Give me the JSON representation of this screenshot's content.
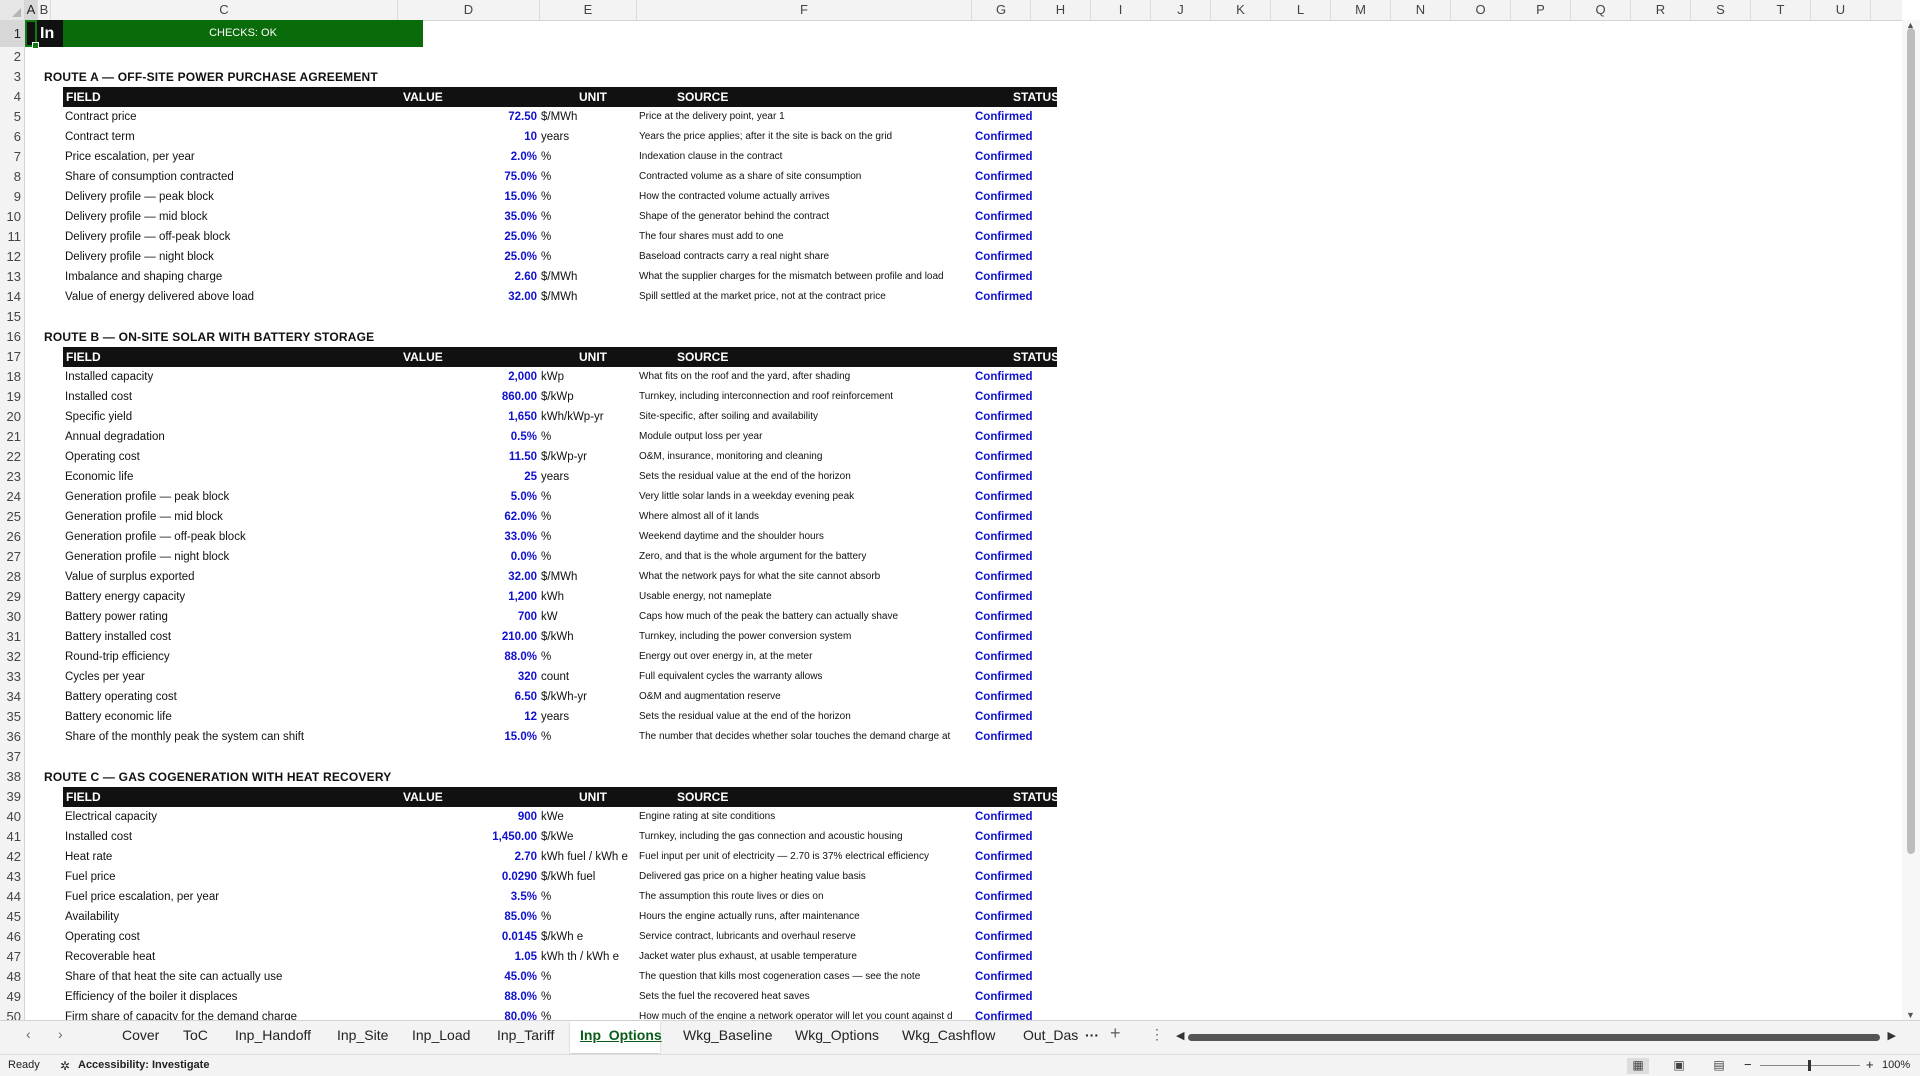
{
  "columns": [
    "A",
    "B",
    "C",
    "D",
    "E",
    "F",
    "G",
    "H",
    "I",
    "J",
    "K",
    "L",
    "M",
    "N",
    "O",
    "P",
    "Q",
    "R",
    "S",
    "T",
    "U"
  ],
  "selected_column": "A",
  "selected_row": 1,
  "rows": [
    "1",
    "2",
    "3",
    "4",
    "5",
    "6",
    "7",
    "8",
    "9",
    "10",
    "11",
    "12",
    "13",
    "14",
    "15",
    "16",
    "17",
    "18",
    "19",
    "20",
    "21",
    "22",
    "23",
    "24",
    "25",
    "26",
    "27",
    "28",
    "29",
    "30",
    "31",
    "32",
    "33",
    "34",
    "35",
    "36",
    "37",
    "38",
    "39",
    "40",
    "41",
    "42",
    "43",
    "44",
    "45",
    "46",
    "47",
    "48",
    "49",
    "50"
  ],
  "banner": {
    "title_fragment": "In",
    "checks_label": "CHECKS: OK",
    "checks_color": "#0a6b0a"
  },
  "table_headers": {
    "field": "FIELD",
    "value": "VALUE",
    "unit": "UNIT",
    "source": "SOURCE",
    "status": "STATUS"
  },
  "sections": [
    {
      "title": "ROUTE A — OFF-SITE POWER PURCHASE AGREEMENT",
      "rows": [
        {
          "field": "Contract price",
          "value": "72.50",
          "unit": "$/MWh",
          "source": "Price at the delivery point, year 1",
          "status": "Confirmed"
        },
        {
          "field": "Contract term",
          "value": "10",
          "unit": "years",
          "source": "Years the price applies; after it the site is back on the grid",
          "status": "Confirmed"
        },
        {
          "field": "Price escalation, per year",
          "value": "2.0%",
          "unit": "%",
          "source": "Indexation clause in the contract",
          "status": "Confirmed"
        },
        {
          "field": "Share of consumption contracted",
          "value": "75.0%",
          "unit": "%",
          "source": "Contracted volume as a share of site consumption",
          "status": "Confirmed"
        },
        {
          "field": "Delivery profile — peak block",
          "value": "15.0%",
          "unit": "%",
          "source": "How the contracted volume actually arrives",
          "status": "Confirmed"
        },
        {
          "field": "Delivery profile — mid block",
          "value": "35.0%",
          "unit": "%",
          "source": "Shape of the generator behind the contract",
          "status": "Confirmed"
        },
        {
          "field": "Delivery profile — off-peak block",
          "value": "25.0%",
          "unit": "%",
          "source": "The four shares must add to one",
          "status": "Confirmed"
        },
        {
          "field": "Delivery profile — night block",
          "value": "25.0%",
          "unit": "%",
          "source": "Baseload contracts carry a real night share",
          "status": "Confirmed"
        },
        {
          "field": "Imbalance and shaping charge",
          "value": "2.60",
          "unit": "$/MWh",
          "source": "What the supplier charges for the mismatch between profile and load",
          "status": "Confirmed"
        },
        {
          "field": "Value of energy delivered above load",
          "value": "32.00",
          "unit": "$/MWh",
          "source": "Spill settled at the market price, not at the contract price",
          "status": "Confirmed"
        }
      ]
    },
    {
      "title": "ROUTE B — ON-SITE SOLAR WITH BATTERY STORAGE",
      "rows": [
        {
          "field": "Installed capacity",
          "value": "2,000",
          "unit": "kWp",
          "source": "What fits on the roof and the yard, after shading",
          "status": "Confirmed"
        },
        {
          "field": "Installed cost",
          "value": "860.00",
          "unit": "$/kWp",
          "source": "Turnkey, including interconnection and roof reinforcement",
          "status": "Confirmed"
        },
        {
          "field": "Specific yield",
          "value": "1,650",
          "unit": "kWh/kWp-yr",
          "source": "Site-specific, after soiling and availability",
          "status": "Confirmed"
        },
        {
          "field": "Annual degradation",
          "value": "0.5%",
          "unit": "%",
          "source": "Module output loss per year",
          "status": "Confirmed"
        },
        {
          "field": "Operating cost",
          "value": "11.50",
          "unit": "$/kWp-yr",
          "source": "O&M, insurance, monitoring and cleaning",
          "status": "Confirmed"
        },
        {
          "field": "Economic life",
          "value": "25",
          "unit": "years",
          "source": "Sets the residual value at the end of the horizon",
          "status": "Confirmed"
        },
        {
          "field": "Generation profile — peak block",
          "value": "5.0%",
          "unit": "%",
          "source": "Very little solar lands in a weekday evening peak",
          "status": "Confirmed"
        },
        {
          "field": "Generation profile — mid block",
          "value": "62.0%",
          "unit": "%",
          "source": "Where almost all of it lands",
          "status": "Confirmed"
        },
        {
          "field": "Generation profile — off-peak block",
          "value": "33.0%",
          "unit": "%",
          "source": "Weekend daytime and the shoulder hours",
          "status": "Confirmed"
        },
        {
          "field": "Generation profile — night block",
          "value": "0.0%",
          "unit": "%",
          "source": "Zero, and that is the whole argument for the battery",
          "status": "Confirmed"
        },
        {
          "field": "Value of surplus exported",
          "value": "32.00",
          "unit": "$/MWh",
          "source": "What the network pays for what the site cannot absorb",
          "status": "Confirmed"
        },
        {
          "field": "Battery energy capacity",
          "value": "1,200",
          "unit": "kWh",
          "source": "Usable energy, not nameplate",
          "status": "Confirmed"
        },
        {
          "field": "Battery power rating",
          "value": "700",
          "unit": "kW",
          "source": "Caps how much of the peak the battery can actually shave",
          "status": "Confirmed"
        },
        {
          "field": "Battery installed cost",
          "value": "210.00",
          "unit": "$/kWh",
          "source": "Turnkey, including the power conversion system",
          "status": "Confirmed"
        },
        {
          "field": "Round-trip efficiency",
          "value": "88.0%",
          "unit": "%",
          "source": "Energy out over energy in, at the meter",
          "status": "Confirmed"
        },
        {
          "field": "Cycles per year",
          "value": "320",
          "unit": "count",
          "source": "Full equivalent cycles the warranty allows",
          "status": "Confirmed"
        },
        {
          "field": "Battery operating cost",
          "value": "6.50",
          "unit": "$/kWh-yr",
          "source": "O&M and augmentation reserve",
          "status": "Confirmed"
        },
        {
          "field": "Battery economic life",
          "value": "12",
          "unit": "years",
          "source": "Sets the residual value at the end of the horizon",
          "status": "Confirmed"
        },
        {
          "field": "Share of the monthly peak the system can shift",
          "value": "15.0%",
          "unit": "%",
          "source": "The number that decides whether solar touches the demand charge at",
          "status": "Confirmed"
        }
      ]
    },
    {
      "title": "ROUTE C — GAS COGENERATION WITH HEAT RECOVERY",
      "rows": [
        {
          "field": "Electrical capacity",
          "value": "900",
          "unit": "kWe",
          "source": "Engine rating at site conditions",
          "status": "Confirmed"
        },
        {
          "field": "Installed cost",
          "value": "1,450.00",
          "unit": "$/kWe",
          "source": "Turnkey, including the gas connection and acoustic housing",
          "status": "Confirmed"
        },
        {
          "field": "Heat rate",
          "value": "2.70",
          "unit": "kWh fuel / kWh e",
          "source": "Fuel input per unit of electricity — 2.70 is 37% electrical efficiency",
          "status": "Confirmed"
        },
        {
          "field": "Fuel price",
          "value": "0.0290",
          "unit": "$/kWh fuel",
          "source": "Delivered gas price on a higher heating value basis",
          "status": "Confirmed"
        },
        {
          "field": "Fuel price escalation, per year",
          "value": "3.5%",
          "unit": "%",
          "source": "The assumption this route lives or dies on",
          "status": "Confirmed"
        },
        {
          "field": "Availability",
          "value": "85.0%",
          "unit": "%",
          "source": "Hours the engine actually runs, after maintenance",
          "status": "Confirmed"
        },
        {
          "field": "Operating cost",
          "value": "0.0145",
          "unit": "$/kWh e",
          "source": "Service contract, lubricants and overhaul reserve",
          "status": "Confirmed"
        },
        {
          "field": "Recoverable heat",
          "value": "1.05",
          "unit": "kWh th / kWh e",
          "source": "Jacket water plus exhaust, at usable temperature",
          "status": "Confirmed"
        },
        {
          "field": "Share of that heat the site can actually use",
          "value": "45.0%",
          "unit": "%",
          "source": "The question that kills most cogeneration cases — see the note",
          "status": "Confirmed"
        },
        {
          "field": "Efficiency of the boiler it displaces",
          "value": "88.0%",
          "unit": "%",
          "source": "Sets the fuel the recovered heat saves",
          "status": "Confirmed"
        },
        {
          "field": "Firm share of capacity for the demand charge",
          "value": "80.0%",
          "unit": "%",
          "source": "How much of the engine a network operator will let you count against d",
          "status": "Confirmed"
        }
      ]
    }
  ],
  "sheet_tabs": [
    "Cover",
    "ToC",
    "Inp_Handoff",
    "Inp_Site",
    "Inp_Load",
    "Inp_Tariff",
    "Inp_Options",
    "Wkg_Baseline",
    "Wkg_Options",
    "Wkg_Cashflow",
    "Out_Das"
  ],
  "active_tab": "Inp_Options",
  "statusbar": {
    "ready": "Ready",
    "accessibility": "Accessibility: Investigate",
    "zoom": "100%"
  }
}
